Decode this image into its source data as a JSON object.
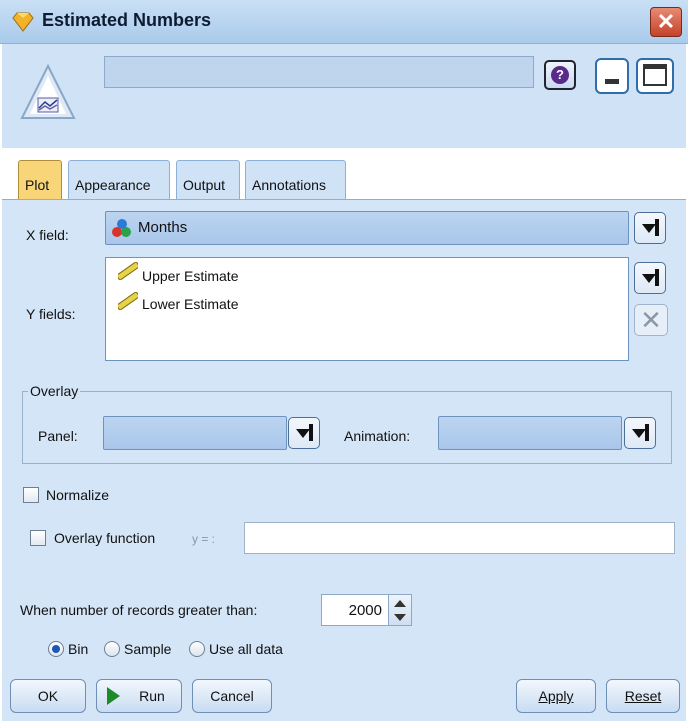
{
  "window": {
    "title": "Estimated Numbers",
    "close": "✕"
  },
  "header": {
    "help_symbol": "?"
  },
  "tabs": [
    {
      "label": "Plot"
    },
    {
      "label": "Appearance"
    },
    {
      "label": "Output"
    },
    {
      "label": "Annotations"
    }
  ],
  "plot": {
    "x_field_label": "X field:",
    "x_field_value": "Months",
    "x_field_icon": "nominal-field-icon",
    "y_fields_label": "Y fields:",
    "y_fields": [
      "Upper Estimate",
      "Lower Estimate"
    ],
    "y_field_icon": "continuous-field-icon",
    "remove_symbol": "✕"
  },
  "overlay": {
    "legend": "Overlay",
    "panel_label": "Panel:",
    "panel_value": "",
    "animation_label": "Animation:",
    "animation_value": ""
  },
  "options": {
    "normalize_label": "Normalize",
    "normalize_checked": false,
    "overlay_function_label": "Overlay function",
    "overlay_function_checked": false,
    "overlay_function_prefix": "y = :",
    "overlay_function_value": ""
  },
  "records": {
    "label": "When number of records greater than:",
    "value": "2000",
    "modes": [
      "Bin",
      "Sample",
      "Use all data"
    ],
    "selected_mode": "Bin"
  },
  "buttons": {
    "ok": "OK",
    "run": "Run",
    "cancel": "Cancel",
    "apply": "Apply",
    "reset": "Reset"
  },
  "colors": {
    "tab_active": "#f9d57a",
    "panel_bg": "#d4e5f7",
    "combo_bg": "#a9c6ea"
  }
}
